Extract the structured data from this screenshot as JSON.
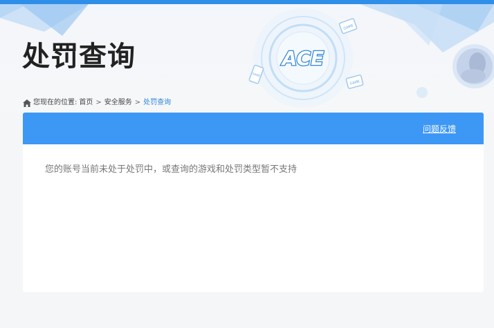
{
  "page": {
    "title": "处罚查询"
  },
  "breadcrumb": {
    "label": "您现在的位置:",
    "items": [
      "首页",
      "安全服务",
      "处罚查询"
    ],
    "separator": ">"
  },
  "panel": {
    "feedback_link": "问题反馈",
    "message": "您的账号当前未处于处罚中，或查询的游戏和处罚类型暂不支持"
  },
  "banner": {
    "logo_text": "ACE",
    "tile_labels": [
      "GAME",
      "GAME",
      "GAME"
    ]
  },
  "colors": {
    "accent": "#3d98f5",
    "top_strip": "#2f8fe8",
    "breadcrumb_current": "#2f86d9",
    "background": "#f5f6f8"
  },
  "icons": {
    "breadcrumb": "home-icon",
    "logo": "ace-logo-icon"
  }
}
